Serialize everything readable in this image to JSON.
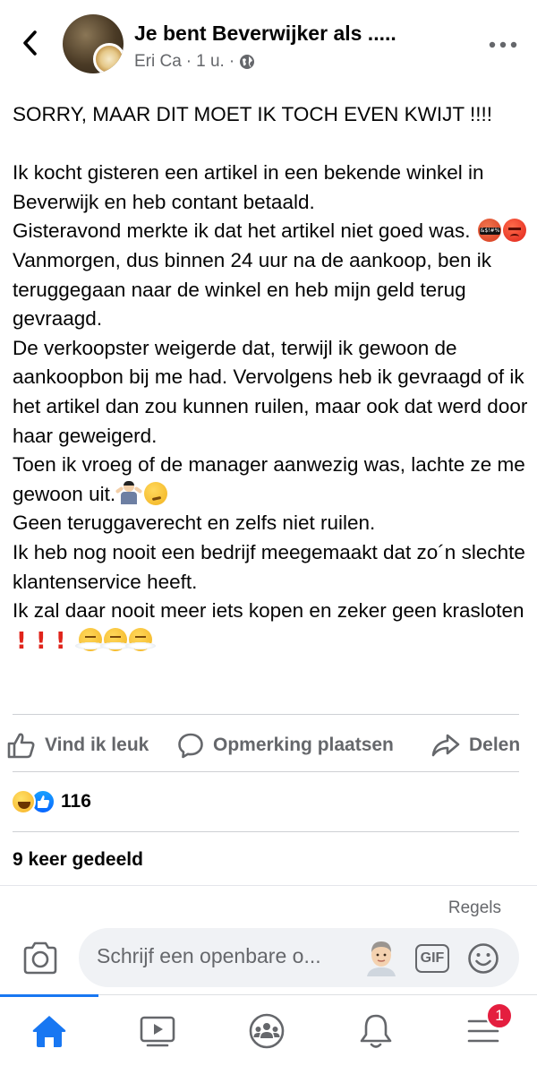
{
  "header": {
    "title": "Je bent Beverwijker als .....",
    "author": "Eri Ca",
    "time": "1 u.",
    "separator": "·",
    "privacy_icon": "globe-icon",
    "back_icon": "chevron-left-icon",
    "more_icon": "more-horizontal-icon"
  },
  "post": {
    "lines": [
      "SORRY, MAAR DIT MOET IK TOCH EVEN KWIJT !!!!",
      "",
      "Ik kocht gisteren een artikel in een bekende winkel in Beverwijk en heb contant betaald.",
      "Gisteravond merkte ik dat het artikel niet goed was.",
      "Vanmorgen, dus binnen 24 uur na de aankoop, ben ik teruggegaan naar de winkel en heb mijn geld terug gevraagd.",
      "De verkoopster weigerde dat, terwijl ik gewoon de aankoopbon bij me had. Vervolgens heb ik gevraagd of ik het artikel dan zou kunnen ruilen, maar ook dat werd door haar geweigerd.",
      "Toen ik vroeg of de manager aanwezig was, lachte ze me gewoon uit.",
      "Geen teruggaverecht en zelfs niet ruilen.",
      "Ik heb nog nooit een bedrijf meegemaakt dat zo´n slechte klantenservice heeft.",
      "Ik zal daar nooit meer iets kopen en zeker geen krasloten"
    ],
    "emoji": {
      "line_was": [
        "face-with-symbols-on-mouth",
        "pouting-face"
      ],
      "line_uit": [
        "man-shrugging",
        "thinking-face"
      ],
      "line_end_marks": [
        "red-exclamation-mark",
        "red-exclamation-mark",
        "red-exclamation-mark"
      ],
      "line_end_faces": [
        "face-with-steam-from-nose",
        "face-with-steam-from-nose",
        "face-with-steam-from-nose"
      ]
    }
  },
  "actions": {
    "like_label": "Vind ik leuk",
    "comment_label": "Opmerking plaatsen",
    "share_label": "Delen"
  },
  "reactions": {
    "types": [
      "haha",
      "like"
    ],
    "count": "116"
  },
  "shares": "9 keer gedeeld",
  "rules_link": "Regels",
  "composer": {
    "placeholder": "Schrijf een openbare o...",
    "camera_icon": "camera-icon",
    "avatar_icon": "avatar-icon",
    "gif_label": "GIF",
    "emoji_icon": "smiley-icon"
  },
  "tabbar": {
    "tabs": [
      "home-icon",
      "video-icon",
      "groups-icon",
      "bell-icon",
      "menu-icon"
    ],
    "active": "home-icon",
    "menu_badge": "1"
  },
  "colors": {
    "accent": "#1877f2",
    "secondary_text": "#65676b",
    "badge": "#e41e3f",
    "composer_bg": "#f0f2f5"
  }
}
